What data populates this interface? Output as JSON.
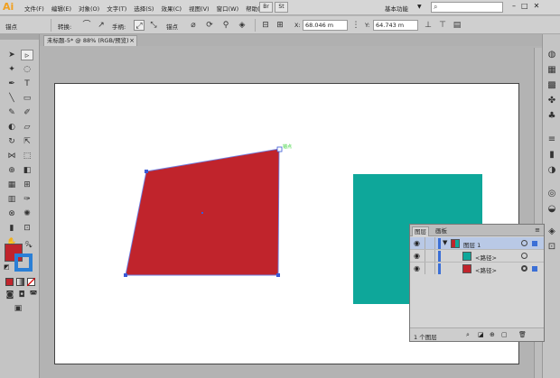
{
  "app": {
    "logo": "Ai"
  },
  "menubar": {
    "items": [
      "文件(F)",
      "编辑(E)",
      "对象(O)",
      "文字(T)",
      "选择(S)",
      "效果(C)",
      "视图(V)",
      "窗口(W)",
      "帮助(H)"
    ],
    "bridge_label": "Br",
    "stock_label": "St",
    "workspace": "基本功能",
    "workspace_arrow": "▼",
    "search_icon": "search-icon",
    "window_buttons": [
      "–",
      "□",
      "✕"
    ]
  },
  "controlbar": {
    "anchor_label": "锚点",
    "convert_label": "转换:",
    "handles_label": "手柄:",
    "anchors_label": "锚点",
    "x_label": "X:",
    "x_value": "68.046 m",
    "y_label": "Y:",
    "y_value": "64.743 m"
  },
  "document": {
    "tab_title": "未标题-5* @ 88% (RGB/预览)",
    "close_glyph": "×"
  },
  "artwork": {
    "quad_color": "#c0242c",
    "square_color": "#0ea79a",
    "anchor_hint": "锚点"
  },
  "layers_panel": {
    "tabs": [
      "图层",
      "画板"
    ],
    "menu_glyph": "≡",
    "rows": [
      {
        "name": "图层 1",
        "thumb_color": "#c0242c",
        "top": true
      },
      {
        "name": "<路径>",
        "thumb_color": "#0ea79a",
        "top": false
      },
      {
        "name": "<路径>",
        "thumb_color": "#c0242c",
        "top": false
      }
    ],
    "layer_count": "1 个图层"
  }
}
